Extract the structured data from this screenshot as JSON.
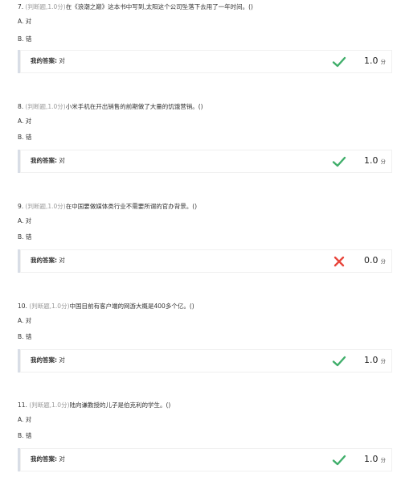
{
  "questions": [
    {
      "number": "7.",
      "type_label": "(判断题,1.0分)",
      "text": "在《浪潮之巅》这本书中写到,太阳这个公司坠落下去用了一年时间。()",
      "option_a": "A. 对",
      "option_b": "B. 错",
      "answer_label": "我的答案:",
      "answer_value": "对",
      "result": "correct",
      "score": "1.0",
      "unit": "分"
    },
    {
      "number": "8.",
      "type_label": "(判断题,1.0分)",
      "text": "小米手机在开出销售的前期做了大量的饥饿营销。()",
      "option_a": "A. 对",
      "option_b": "B. 错",
      "answer_label": "我的答案:",
      "answer_value": "对",
      "result": "correct",
      "score": "1.0",
      "unit": "分"
    },
    {
      "number": "9.",
      "type_label": "(判断题,1.0分)",
      "text": "在中国要做媒体类行业不需要所谓的官办背景。()",
      "option_a": "A. 对",
      "option_b": "B. 错",
      "answer_label": "我的答案:",
      "answer_value": "对",
      "result": "wrong",
      "score": "0.0",
      "unit": "分"
    },
    {
      "number": "10.",
      "type_label": "(判断题,1.0分)",
      "text": "中国目前有客户端的网游大概是400多个亿。()",
      "option_a": "A. 对",
      "option_b": "B. 错",
      "answer_label": "我的答案:",
      "answer_value": "对",
      "result": "correct",
      "score": "1.0",
      "unit": "分"
    },
    {
      "number": "11.",
      "type_label": "(判断题,1.0分)",
      "text": "陆向谦教授的儿子是伯克利的学生。()",
      "option_a": "A. 对",
      "option_b": "B. 错",
      "answer_label": "我的答案:",
      "answer_value": "对",
      "result": "correct",
      "score": "1.0",
      "unit": "分"
    }
  ],
  "icons": {
    "correct": "check-icon",
    "wrong": "cross-icon"
  },
  "colors": {
    "correct": "#3fae6a",
    "wrong": "#e8463c"
  }
}
